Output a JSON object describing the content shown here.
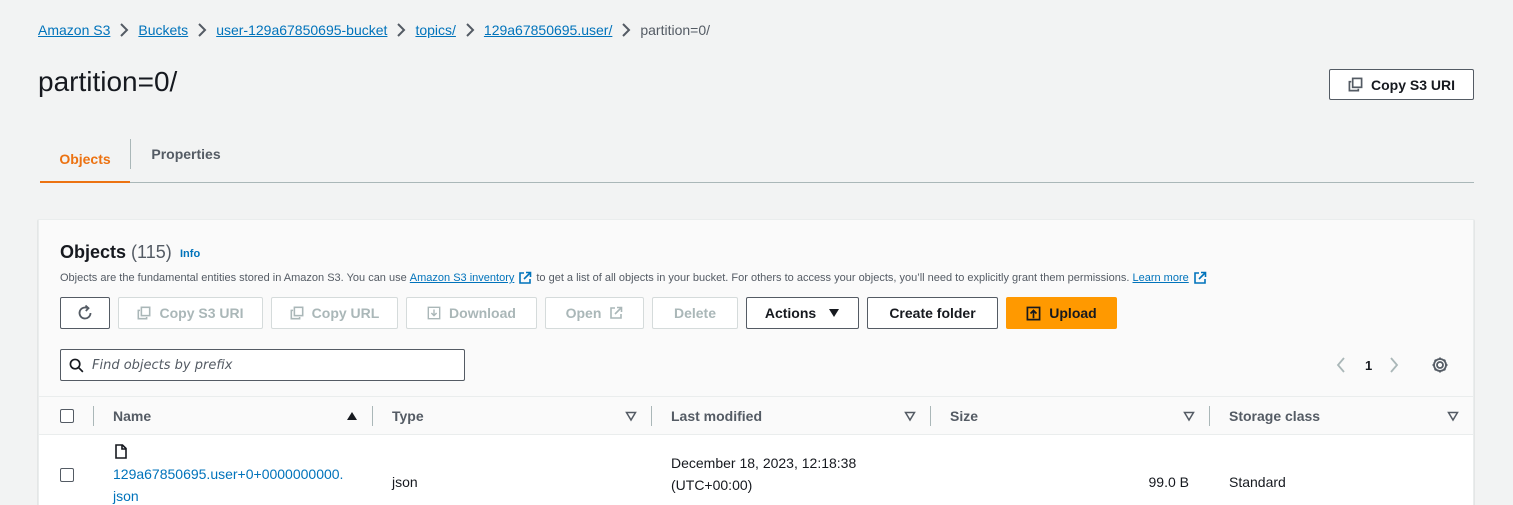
{
  "breadcrumb": [
    "Amazon S3",
    "Buckets",
    "user-129a67850695-bucket",
    "topics/",
    "129a67850695.user/",
    "partition=0/"
  ],
  "page": {
    "title": "partition=0/",
    "copy_s3_uri_label": "Copy S3 URI"
  },
  "tabs": [
    {
      "label": "Objects",
      "active": true
    },
    {
      "label": "Properties",
      "active": false
    }
  ],
  "objects_panel": {
    "title": "Objects",
    "count": "(115)",
    "info_label": "Info",
    "description_pre": "Objects are the fundamental entities stored in Amazon S3. You can use",
    "description_link1": "Amazon S3 inventory",
    "description_mid": "to get a list of all objects in your bucket. For others to access your objects, you’ll need to explicitly grant them permissions.",
    "description_link2": "Learn more"
  },
  "toolbar": {
    "copy_s3_uri": "Copy S3 URI",
    "copy_url": "Copy URL",
    "download": "Download",
    "open": "Open",
    "delete": "Delete",
    "actions": "Actions",
    "create_folder": "Create folder",
    "upload": "Upload"
  },
  "search": {
    "placeholder": "Find objects by prefix"
  },
  "pagination": {
    "current_page": "1"
  },
  "table": {
    "columns": [
      "Name",
      "Type",
      "Last modified",
      "Size",
      "Storage class"
    ],
    "rows": [
      {
        "name_line1": "129a67850695.user+0+0000000000.",
        "name_line2": "json",
        "type": "json",
        "last_modified_line1": "December 18, 2023, 12:18:38",
        "last_modified_line2": "(UTC+00:00)",
        "size": "99.0 B",
        "storage_class": "Standard"
      }
    ]
  },
  "colors": {
    "accent": "#ec7211",
    "link": "#0073bb",
    "primary_button": "#ff9900"
  }
}
